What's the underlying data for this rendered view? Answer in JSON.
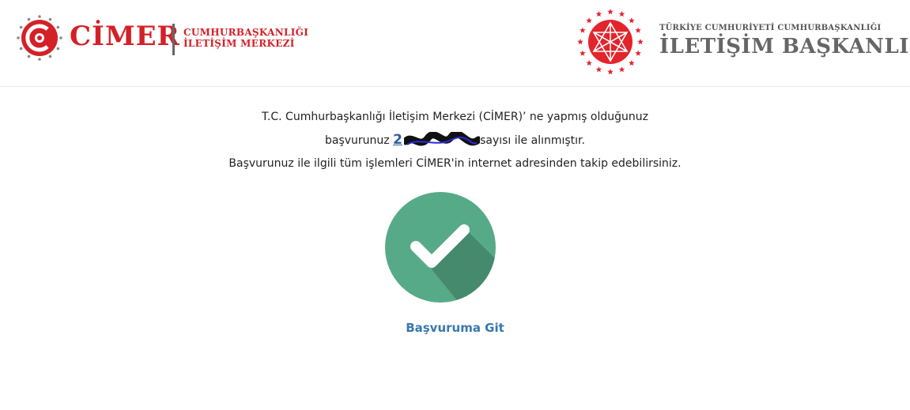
{
  "header": {
    "cimer_word": "CİMER",
    "cimer_sub_line1": "CUMHURBAŞKANLIĞI",
    "cimer_sub_line2": "İLETİŞİM MERKEZİ",
    "iletisim_small": "TÜRKİYE CUMHURİYETİ CUMHURBAŞKANLIĞI",
    "iletisim_big": "İLETİŞİM BAŞKANLIĞI"
  },
  "message": {
    "line1": "T.C. Cumhurbaşkanlığı İletişim Merkezi (CİMER)’ ne yapmış olduğunuz",
    "line2_prefix": "başvurunuz ",
    "ref_number": "2",
    "line2_suffix": "sayısı ile alınmıştır.",
    "line3": "Başvurunuz ile ilgili tüm işlemleri CİMER'in internet adresinden takip edebilirsiniz."
  },
  "actions": {
    "goto_label": "Başvuruma Git"
  },
  "colors": {
    "brand_red": "#d42027",
    "success_green": "#57aa88",
    "link_blue": "#3778b0"
  }
}
